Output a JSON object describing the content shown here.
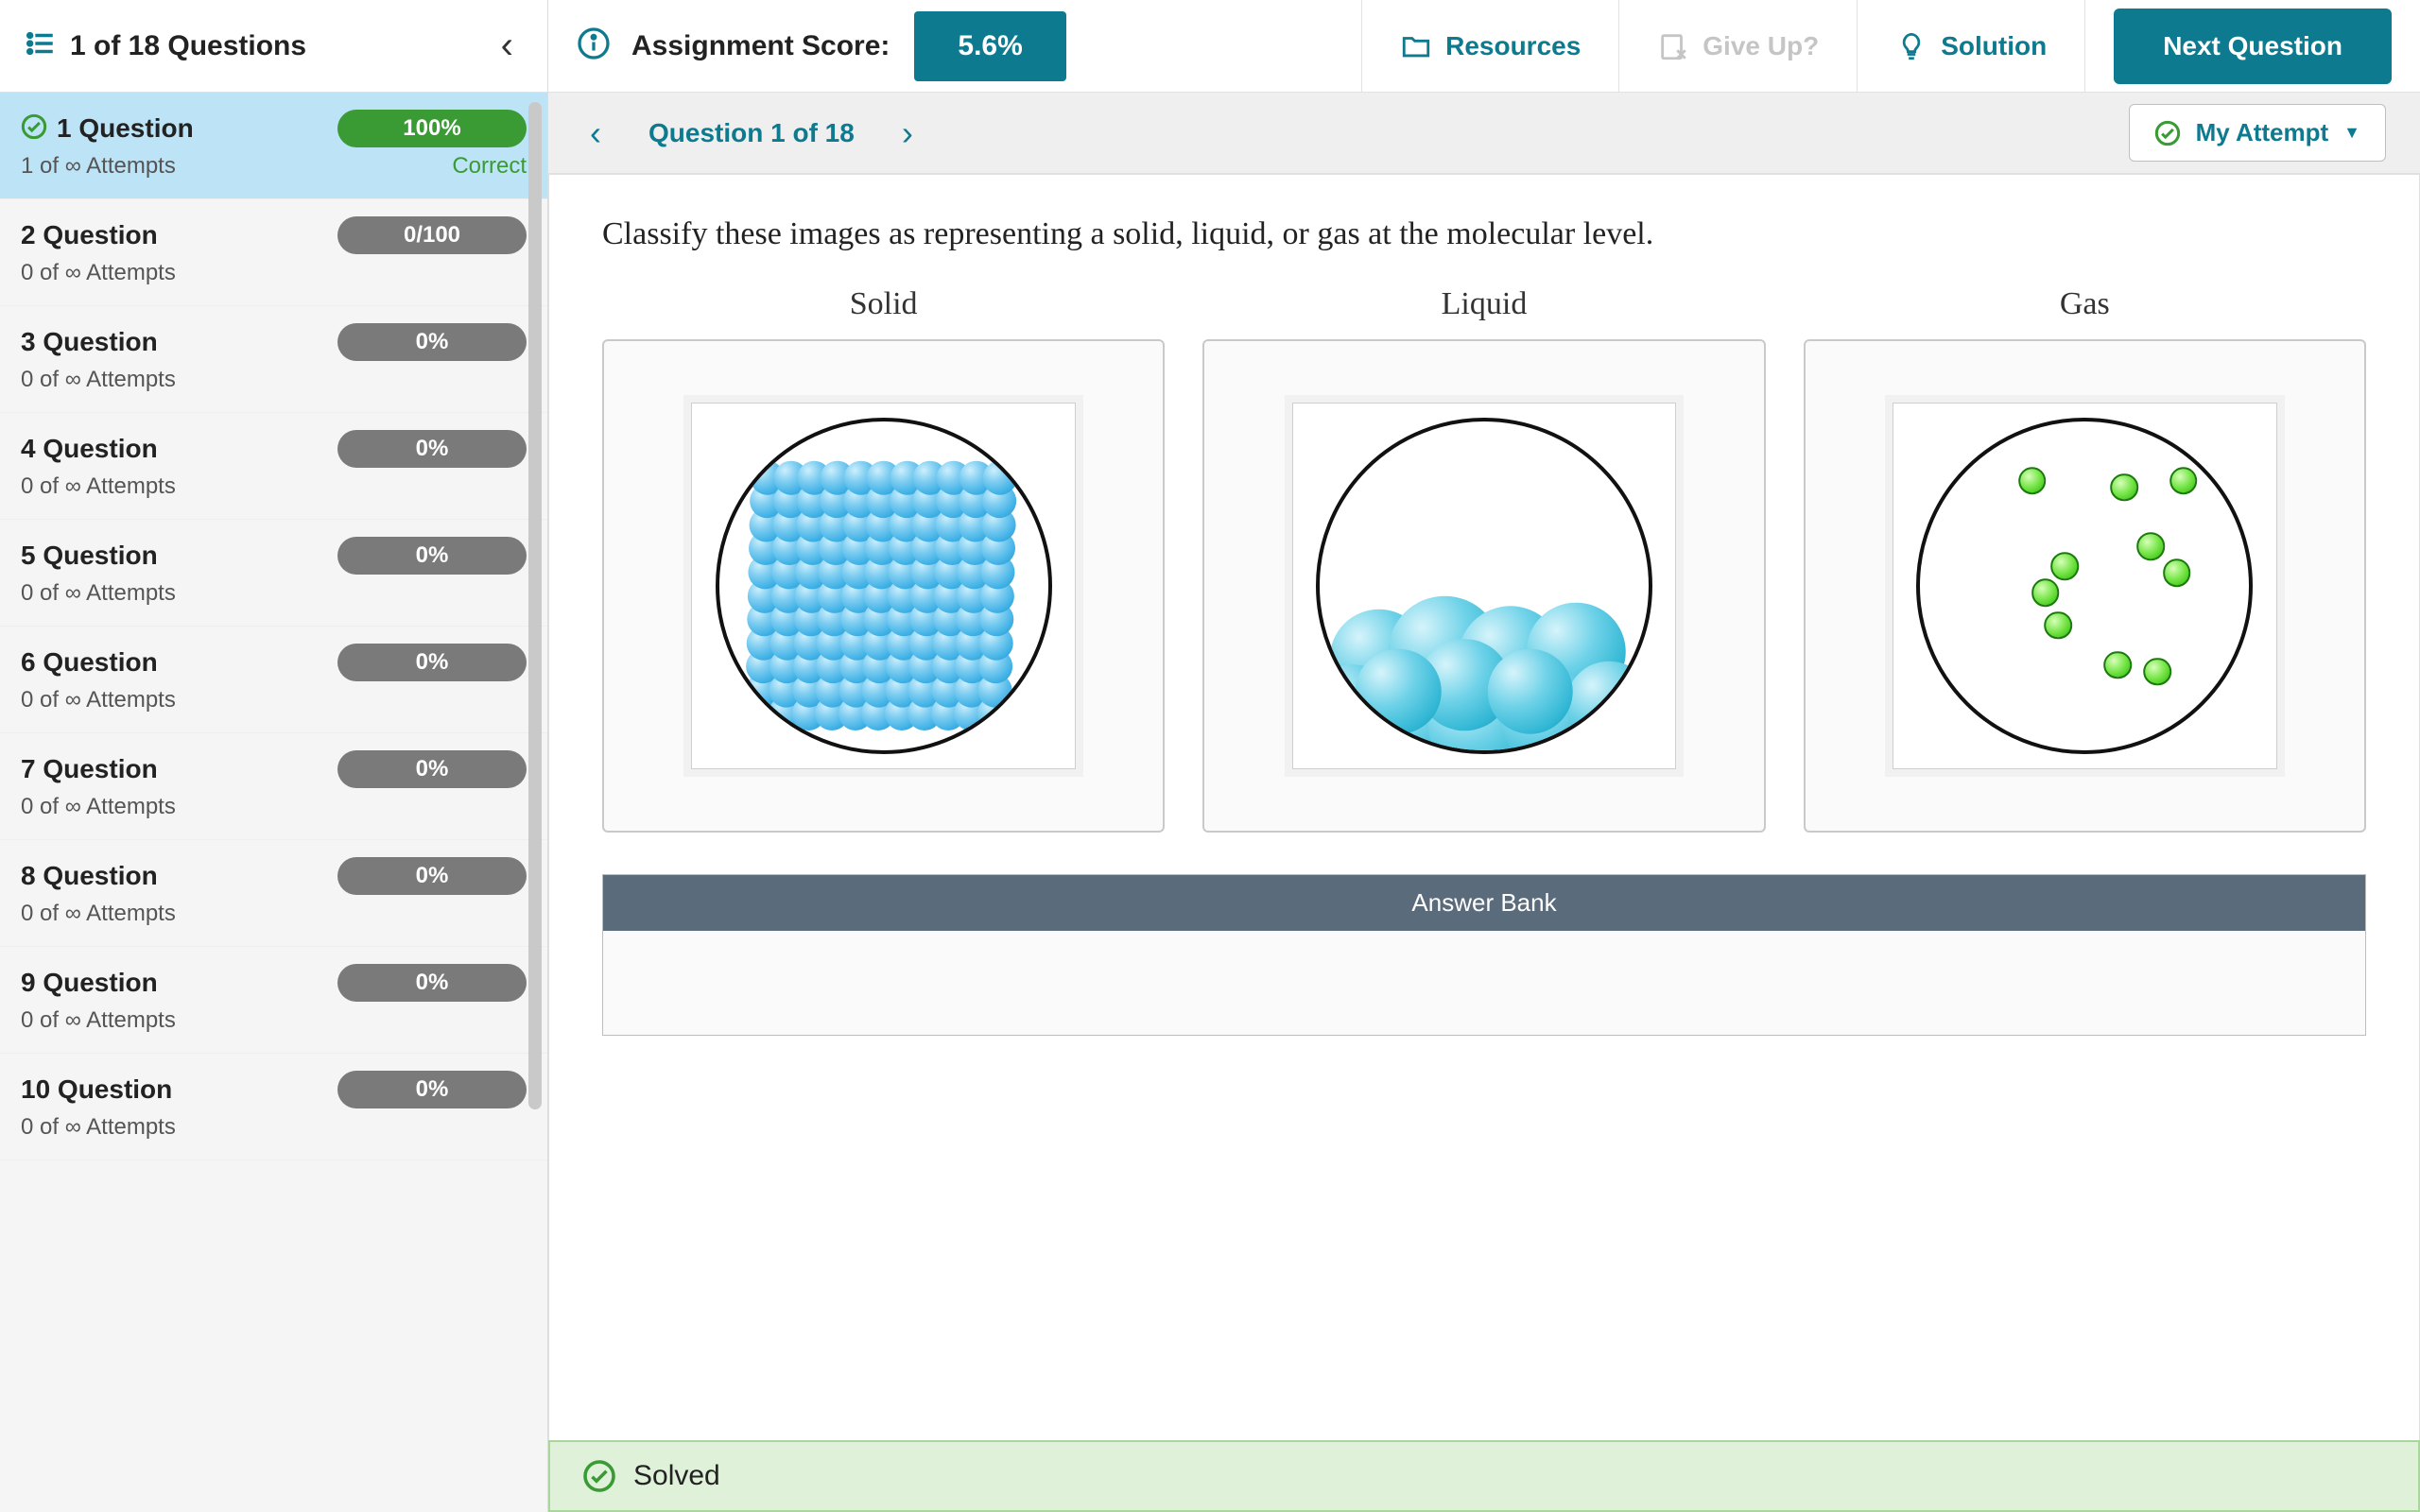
{
  "sidebar": {
    "title": "1 of 18 Questions",
    "items": [
      {
        "label": "1 Question",
        "badge": "100%",
        "badge_style": "green",
        "attempts": "1 of ∞ Attempts",
        "status": "Correct",
        "active": true,
        "check": true
      },
      {
        "label": "2 Question",
        "badge": "0/100",
        "attempts": "0 of ∞ Attempts"
      },
      {
        "label": "3 Question",
        "badge": "0%",
        "attempts": "0 of ∞ Attempts"
      },
      {
        "label": "4 Question",
        "badge": "0%",
        "attempts": "0 of ∞ Attempts"
      },
      {
        "label": "5 Question",
        "badge": "0%",
        "attempts": "0 of ∞ Attempts"
      },
      {
        "label": "6 Question",
        "badge": "0%",
        "attempts": "0 of ∞ Attempts"
      },
      {
        "label": "7 Question",
        "badge": "0%",
        "attempts": "0 of ∞ Attempts"
      },
      {
        "label": "8 Question",
        "badge": "0%",
        "attempts": "0 of ∞ Attempts"
      },
      {
        "label": "9 Question",
        "badge": "0%",
        "attempts": "0 of ∞ Attempts"
      },
      {
        "label": "10 Question",
        "badge": "0%",
        "attempts": "0 of ∞ Attempts"
      }
    ]
  },
  "topbar": {
    "score_label": "Assignment Score:",
    "score_value": "5.6%",
    "resources": "Resources",
    "giveup": "Give Up?",
    "solution": "Solution",
    "next": "Next Question"
  },
  "subbar": {
    "counter": "Question 1 of 18",
    "attempt": "My Attempt"
  },
  "content": {
    "prompt": "Classify these images as representing a solid, liquid, or gas at the molecular level.",
    "categories": [
      "Solid",
      "Liquid",
      "Gas"
    ],
    "answer_bank_title": "Answer Bank"
  },
  "footer": {
    "label": "Solved"
  },
  "colors": {
    "brand": "#0d7a8f",
    "success": "#3a9b35",
    "footer_bg": "#dff1d9"
  }
}
